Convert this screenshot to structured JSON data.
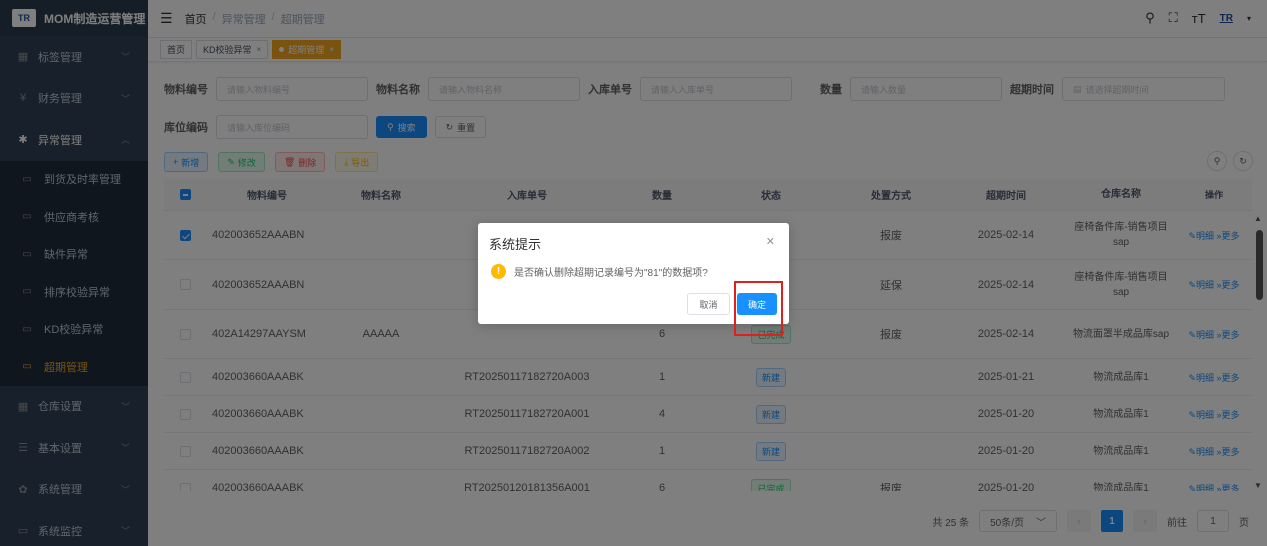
{
  "app": {
    "logo_text": "TR",
    "title": "MOM制造运营管理"
  },
  "sidebar": {
    "items": [
      {
        "icon": "table-icon",
        "glyph": "▦",
        "label": "标签管理",
        "open": false
      },
      {
        "icon": "yen-icon",
        "glyph": "¥",
        "label": "财务管理",
        "open": false
      },
      {
        "icon": "bug-icon",
        "glyph": "✱",
        "label": "异常管理",
        "open": true
      }
    ],
    "subitems": [
      {
        "label": "到货及时率管理",
        "active": false
      },
      {
        "label": "供应商考核",
        "active": false
      },
      {
        "label": "缺件异常",
        "active": false
      },
      {
        "label": "排序校验异常",
        "active": false
      },
      {
        "label": "KD校验异常",
        "active": false
      },
      {
        "label": "超期管理",
        "active": true
      }
    ],
    "items_after": [
      {
        "icon": "grid-icon",
        "glyph": "▦",
        "label": "仓库设置"
      },
      {
        "icon": "list-icon",
        "glyph": "☰",
        "label": "基本设置"
      },
      {
        "icon": "gear-icon",
        "glyph": "✿",
        "label": "系统管理"
      },
      {
        "icon": "monitor-icon",
        "glyph": "▭",
        "label": "系统监控"
      }
    ]
  },
  "header": {
    "breadcrumb": [
      "首页",
      "异常管理",
      "超期管理"
    ],
    "brand_mini": "TR"
  },
  "tags": [
    {
      "label": "首页",
      "active": false,
      "closable": false
    },
    {
      "label": "KD校验异常",
      "active": false,
      "closable": true
    },
    {
      "label": "超期管理",
      "active": true,
      "closable": true
    }
  ],
  "search": {
    "material_code": {
      "label": "物料编号",
      "placeholder": "请输入物料编号"
    },
    "material_name": {
      "label": "物料名称",
      "placeholder": "请输入物料名称"
    },
    "inbound_no": {
      "label": "入库单号",
      "placeholder": "请输入入库单号"
    },
    "quantity": {
      "label": "数量",
      "placeholder": "请输入数量"
    },
    "overdue_time": {
      "label": "超期时间",
      "placeholder": "请选择超期时间"
    },
    "location_code": {
      "label": "库位编码",
      "placeholder": "请输入库位编码"
    },
    "search_btn": "搜索",
    "reset_btn": "重置"
  },
  "toolbar": {
    "add": "新增",
    "edit": "修改",
    "delete": "删除",
    "export": "导出"
  },
  "table": {
    "columns": [
      "物料编号",
      "物料名称",
      "入库单号",
      "数量",
      "状态",
      "处置方式",
      "超期时间",
      "仓库名称",
      "操作"
    ],
    "op_detail": "明细",
    "op_more": "更多",
    "rows": [
      {
        "checked": true,
        "code": "402003652AAABN",
        "name": "",
        "inbound": "",
        "qty": "",
        "status": "",
        "handle": "报废",
        "time": "2025-02-14",
        "warehouse": "座椅备件库-销售项目sap"
      },
      {
        "checked": false,
        "code": "402003652AAABN",
        "name": "",
        "inbound": "",
        "qty": "",
        "status": "",
        "handle": "延保",
        "time": "2025-02-14",
        "warehouse": "座椅备件库-销售项目sap"
      },
      {
        "checked": false,
        "code": "402A14297AAYSM",
        "name": "AAAAA",
        "inbound": "",
        "qty": "6",
        "status": "已完成",
        "handle": "报废",
        "time": "2025-02-14",
        "warehouse": "物流面罩半成品库sap"
      },
      {
        "checked": false,
        "code": "402003660AAABK",
        "name": "",
        "inbound": "RT20250117182720A003",
        "qty": "1",
        "status": "新建",
        "handle": "",
        "time": "2025-01-21",
        "warehouse": "物流成品库1"
      },
      {
        "checked": false,
        "code": "402003660AAABK",
        "name": "",
        "inbound": "RT20250117182720A001",
        "qty": "4",
        "status": "新建",
        "handle": "",
        "time": "2025-01-20",
        "warehouse": "物流成品库1"
      },
      {
        "checked": false,
        "code": "402003660AAABK",
        "name": "",
        "inbound": "RT20250117182720A002",
        "qty": "1",
        "status": "新建",
        "handle": "",
        "time": "2025-01-20",
        "warehouse": "物流成品库1"
      },
      {
        "checked": false,
        "code": "402003660AAABK",
        "name": "",
        "inbound": "RT20250120181356A001",
        "qty": "6",
        "status": "已完成",
        "handle": "报废",
        "time": "2025-01-20",
        "warehouse": "物流成品库1"
      }
    ]
  },
  "pagination": {
    "total": "共 25 条",
    "page_size": "50条/页",
    "current": "1",
    "goto_prefix": "前往",
    "goto_value": "1",
    "goto_suffix": "页"
  },
  "dialog": {
    "title": "系统提示",
    "message": "是否确认删除超期记录编号为\"81\"的数据项?",
    "cancel": "取消",
    "confirm": "确定"
  }
}
